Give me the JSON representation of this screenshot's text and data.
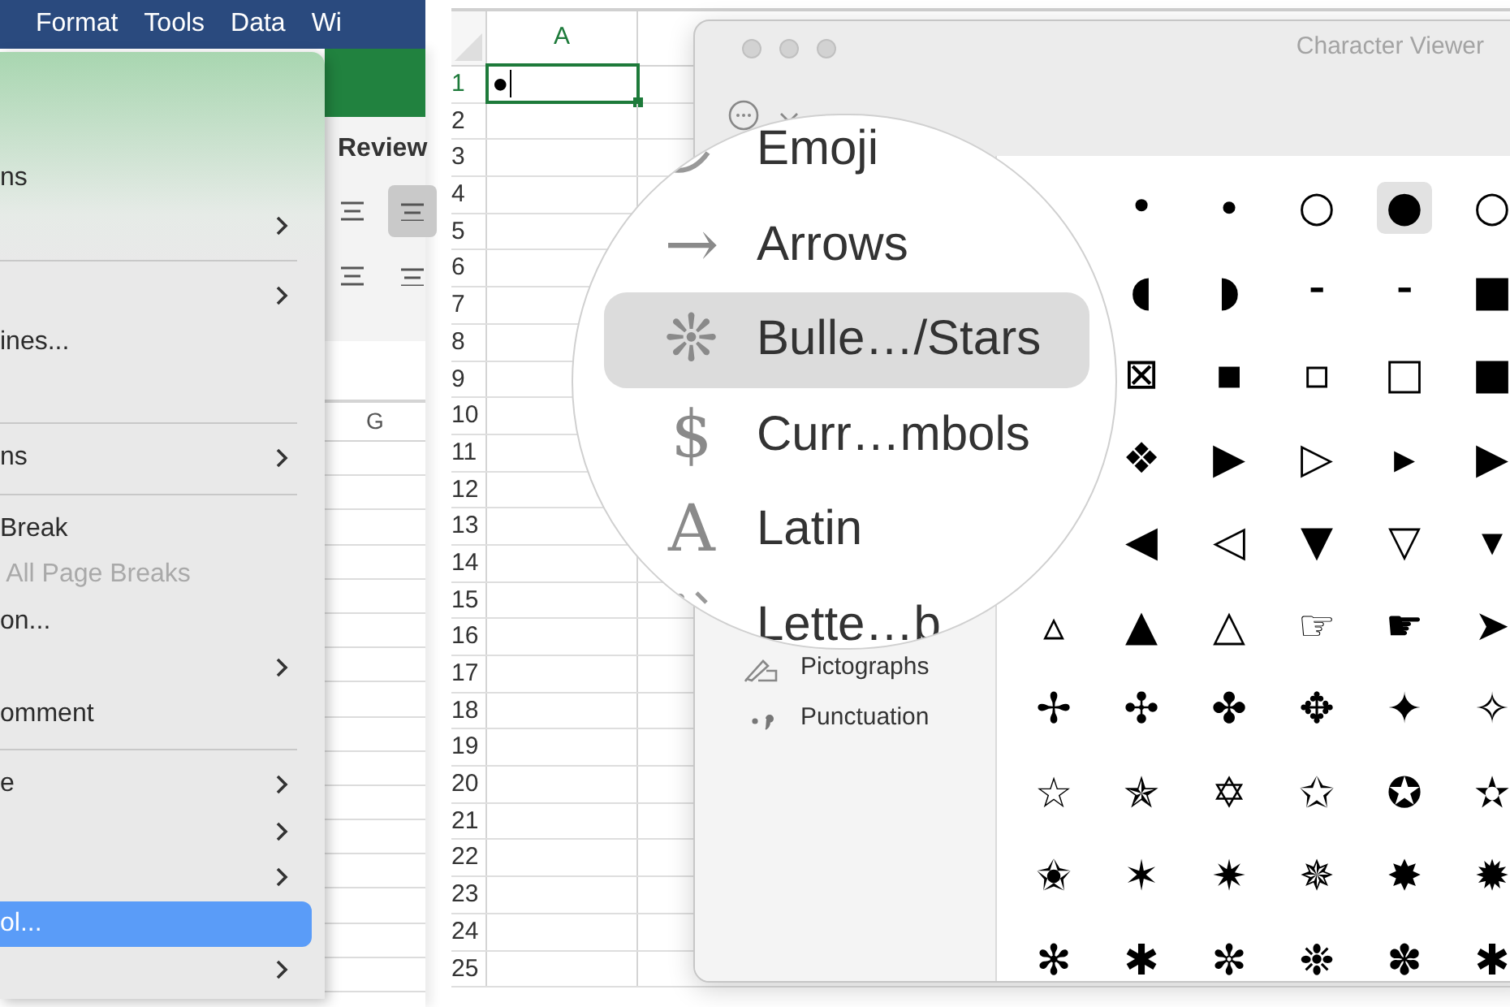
{
  "menu_bar": {
    "items": [
      {
        "label": "Format"
      },
      {
        "label": "Tools"
      },
      {
        "label": "Data"
      },
      {
        "label": "Wi"
      }
    ]
  },
  "menu": {
    "items": [
      {
        "kind": "blank"
      },
      {
        "kind": "blank"
      },
      {
        "kind": "item",
        "label": "ns",
        "submenu": false,
        "disabled": false,
        "selected": false
      },
      {
        "kind": "item",
        "submenu": true,
        "disabled": false,
        "selected": false
      },
      {
        "kind": "separator"
      },
      {
        "kind": "item",
        "submenu": true,
        "disabled": false,
        "selected": false
      },
      {
        "kind": "item",
        "label": "ines...",
        "submenu": false,
        "disabled": false,
        "selected": false
      },
      {
        "kind": "blank"
      },
      {
        "kind": "separator"
      },
      {
        "kind": "item",
        "label": "ns",
        "submenu": true,
        "disabled": false,
        "selected": false
      },
      {
        "kind": "separator"
      },
      {
        "kind": "item",
        "label": "Break",
        "submenu": false,
        "disabled": false,
        "selected": false
      },
      {
        "kind": "item",
        "label": " All Page Breaks",
        "submenu": false,
        "disabled": true,
        "selected": false
      },
      {
        "kind": "item",
        "label": "on...",
        "submenu": false,
        "disabled": false,
        "selected": false
      },
      {
        "kind": "item",
        "submenu": true,
        "disabled": false,
        "selected": false
      },
      {
        "kind": "item",
        "label": "omment",
        "submenu": false,
        "disabled": false,
        "selected": false
      },
      {
        "kind": "separator"
      },
      {
        "kind": "item",
        "label": "e",
        "submenu": true,
        "disabled": false,
        "selected": false
      },
      {
        "kind": "item",
        "submenu": true,
        "disabled": false,
        "selected": false
      },
      {
        "kind": "item",
        "submenu": true,
        "disabled": false,
        "selected": false
      },
      {
        "kind": "item",
        "label": "ol...",
        "submenu": false,
        "disabled": false,
        "selected": true
      },
      {
        "kind": "item",
        "submenu": true,
        "disabled": false,
        "selected": false
      }
    ]
  },
  "ribbon": {
    "tab": "Review",
    "align_buttons": [
      {
        "selected": false
      },
      {
        "selected": true
      },
      {
        "selected": false
      },
      {
        "selected": false
      }
    ],
    "column_header": "G"
  },
  "sheet": {
    "column_header": "A",
    "active_cell": "●",
    "rows": [
      {
        "label": "1",
        "selected": true
      },
      {
        "label": "2",
        "selected": false
      },
      {
        "label": "3",
        "selected": false
      },
      {
        "label": "4",
        "selected": false
      },
      {
        "label": "5",
        "selected": false
      },
      {
        "label": "6",
        "selected": false
      },
      {
        "label": "7",
        "selected": false
      },
      {
        "label": "8",
        "selected": false
      },
      {
        "label": "9",
        "selected": false
      },
      {
        "label": "10",
        "selected": false
      },
      {
        "label": "11",
        "selected": false
      },
      {
        "label": "12",
        "selected": false
      },
      {
        "label": "13",
        "selected": false
      },
      {
        "label": "14",
        "selected": false
      },
      {
        "label": "15",
        "selected": false
      },
      {
        "label": "16",
        "selected": false
      },
      {
        "label": "17",
        "selected": false
      },
      {
        "label": "18",
        "selected": false
      },
      {
        "label": "19",
        "selected": false
      },
      {
        "label": "20",
        "selected": false
      },
      {
        "label": "21",
        "selected": false
      },
      {
        "label": "22",
        "selected": false
      },
      {
        "label": "23",
        "selected": false
      },
      {
        "label": "24",
        "selected": false
      },
      {
        "label": "25",
        "selected": false
      }
    ]
  },
  "character_viewer": {
    "title": "Character Viewer",
    "sidebar": [
      {
        "label": "Pictographs"
      },
      {
        "label": "Punctuation"
      }
    ],
    "magnified_categories": [
      {
        "label": "Emoji",
        "selected": false
      },
      {
        "label": "Arrows",
        "icon": "→",
        "selected": false
      },
      {
        "label": "Bulle…/Stars",
        "icon": "❊",
        "selected": true
      },
      {
        "label": "Curr…mbols",
        "icon": "$",
        "selected": false
      },
      {
        "label": "Latin",
        "icon": "A",
        "selected": false
      },
      {
        "label": "Lette…b",
        "selected": false
      }
    ],
    "characters": [
      [
        {
          "char": "•",
          "selected": false
        },
        {
          "char": "∙",
          "selected": false
        },
        {
          "char": "○",
          "selected": false
        },
        {
          "char": "●",
          "selected": true
        },
        {
          "char": "○",
          "selected": false
        }
      ],
      [
        {
          "char": "◖",
          "selected": false
        },
        {
          "char": "◗",
          "selected": false
        },
        {
          "char": "⁃",
          "selected": false
        },
        {
          "char": "⁃",
          "selected": false
        },
        {
          "char": "■",
          "selected": false
        }
      ],
      [
        {
          "char": "⊠",
          "selected": false
        },
        {
          "char": "▪",
          "selected": false
        },
        {
          "char": "▫",
          "selected": false
        },
        {
          "char": "□",
          "selected": false
        },
        {
          "char": "■",
          "selected": false
        }
      ],
      [
        {
          "char": "❖",
          "selected": false
        },
        {
          "char": "▶",
          "selected": false
        },
        {
          "char": "▷",
          "selected": false
        },
        {
          "char": "▸",
          "selected": false
        },
        {
          "char": "▶",
          "selected": false
        }
      ],
      [
        {
          "char": "◀",
          "selected": false
        },
        {
          "char": "◁",
          "selected": false
        },
        {
          "char": "▼",
          "selected": false
        },
        {
          "char": "▽",
          "selected": false
        },
        {
          "char": "▾",
          "selected": false
        }
      ],
      [
        {
          "char": "▵",
          "selected": false
        },
        {
          "char": "▲",
          "selected": false
        },
        {
          "char": "△",
          "selected": false
        },
        {
          "char": "☞",
          "selected": false
        },
        {
          "char": "☛",
          "selected": false
        },
        {
          "char": "➤",
          "selected": false
        }
      ],
      [
        {
          "char": "✢",
          "selected": false
        },
        {
          "char": "✣",
          "selected": false
        },
        {
          "char": "✤",
          "selected": false
        },
        {
          "char": "✥",
          "selected": false
        },
        {
          "char": "✦",
          "selected": false
        },
        {
          "char": "✧",
          "selected": false
        }
      ],
      [
        {
          "char": "☆",
          "selected": false
        },
        {
          "char": "✯",
          "selected": false
        },
        {
          "char": "✡",
          "selected": false
        },
        {
          "char": "✩",
          "selected": false
        },
        {
          "char": "✪",
          "selected": false
        },
        {
          "char": "✫",
          "selected": false
        }
      ],
      [
        {
          "char": "✬",
          "selected": false
        },
        {
          "char": "✶",
          "selected": false
        },
        {
          "char": "✷",
          "selected": false
        },
        {
          "char": "✵",
          "selected": false
        },
        {
          "char": "✸",
          "selected": false
        },
        {
          "char": "✹",
          "selected": false
        }
      ],
      [
        {
          "char": "✻",
          "selected": false
        },
        {
          "char": "✱",
          "selected": false
        },
        {
          "char": "✼",
          "selected": false
        },
        {
          "char": "❉",
          "selected": false
        },
        {
          "char": "✽",
          "selected": false
        },
        {
          "char": "✱",
          "selected": false
        }
      ]
    ]
  }
}
